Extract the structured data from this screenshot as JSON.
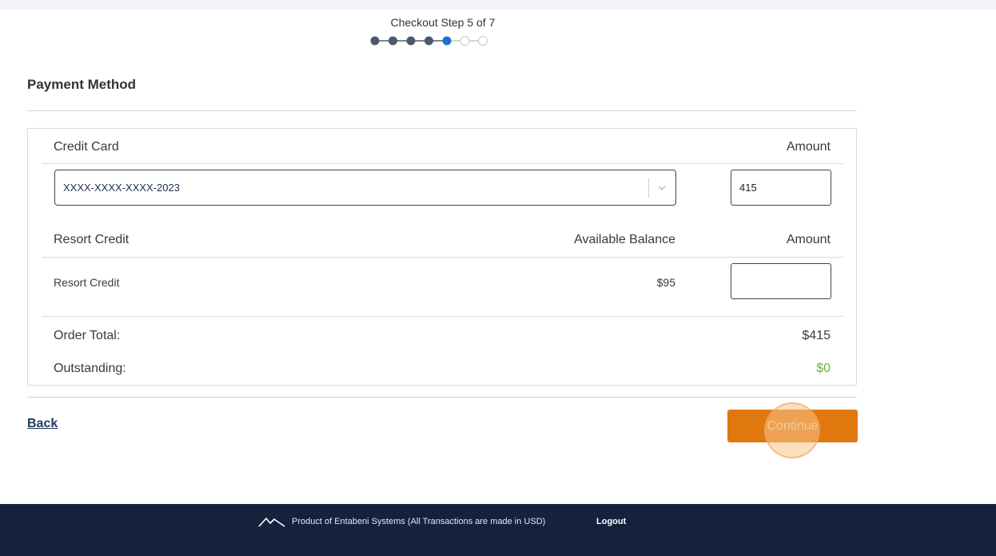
{
  "checkout": {
    "step_label": "Checkout Step 5 of 7",
    "current_step": 5,
    "total_steps": 7
  },
  "section": {
    "title": "Payment Method"
  },
  "credit_card": {
    "header_label": "Credit Card",
    "amount_header": "Amount",
    "selected_card": "XXXX-XXXX-XXXX-2023",
    "amount_value": "415"
  },
  "resort_credit": {
    "header_label": "Resort Credit",
    "balance_header": "Available Balance",
    "amount_header": "Amount",
    "row_label": "Resort Credit",
    "available_balance": "$95",
    "amount_value": ""
  },
  "totals": {
    "order_total_label": "Order Total:",
    "order_total_value": "$415",
    "outstanding_label": "Outstanding:",
    "outstanding_value": "$0"
  },
  "actions": {
    "back_label": "Back",
    "continue_label": "Continue"
  },
  "footer": {
    "text": "Product of Entabeni Systems (All Transactions are made in USD)",
    "logout_label": "Logout"
  },
  "colors": {
    "step_done": "#4d5a6e",
    "step_current": "#1a73c9",
    "accent_orange": "#e0780f",
    "outstanding_green": "#6cb33f",
    "footer_bg": "#16223d"
  },
  "icons": {
    "select_chevron": "chevron-down-icon",
    "footer_logo": "mountain-logo-icon"
  }
}
